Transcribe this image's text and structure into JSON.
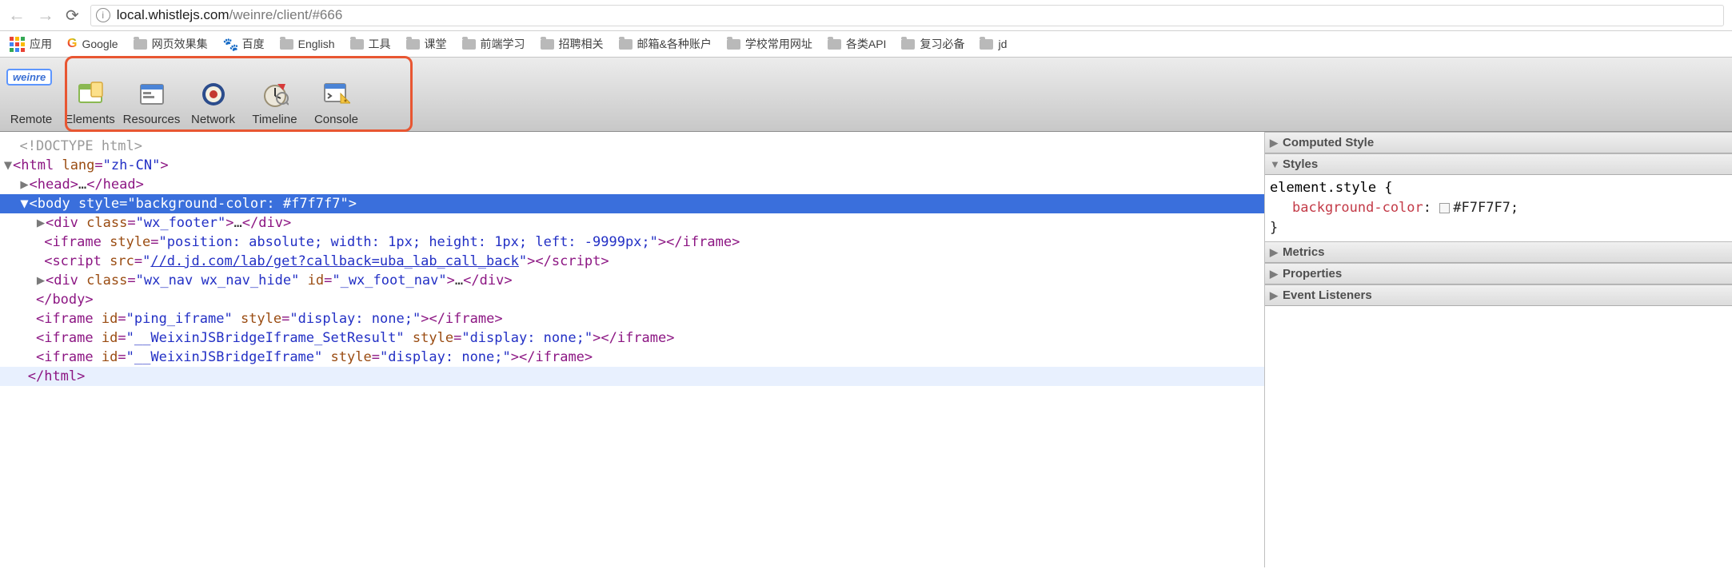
{
  "url": {
    "host": "local.whistlejs.com",
    "path": "/weinre/client/#666"
  },
  "bookmarks": {
    "apps": "应用",
    "google": "Google",
    "items": [
      "网页效果集",
      "百度",
      "English",
      "工具",
      "课堂",
      "前端学习",
      "招聘相关",
      "邮箱&各种账户",
      "学校常用网址",
      "各类API",
      "复习必备",
      "jd"
    ],
    "baidu_index": 1
  },
  "toolbar": {
    "badge": "weinre",
    "items": [
      "Remote",
      "Elements",
      "Resources",
      "Network",
      "Timeline",
      "Console"
    ]
  },
  "dom": {
    "doctype": "<!DOCTYPE html>",
    "html_open": {
      "tag": "html",
      "attr_name": "lang",
      "attr_val": "zh-CN"
    },
    "head": {
      "open_tag": "head",
      "ellipsis": "…",
      "close_tag": "/head"
    },
    "body_open": {
      "tag": "body",
      "attr_name": "style",
      "attr_val": "background-color: #f7f7f7"
    },
    "wx_footer": {
      "tag": "div",
      "a1": "class",
      "v1": "wx_footer",
      "ellipsis": "…",
      "close": "/div"
    },
    "iframe1": {
      "tag": "iframe",
      "a1": "style",
      "v1": "position: absolute; width: 1px; height: 1px; left: -9999px;",
      "close": "/iframe"
    },
    "script1": {
      "tag": "script",
      "a1": "src",
      "link": "//d.jd.com/lab/get?callback=uba_lab_call_back",
      "close": "/script"
    },
    "wx_nav": {
      "tag": "div",
      "a1": "class",
      "v1": "wx_nav wx_nav_hide",
      "a2": "id",
      "v2": "_wx_foot_nav",
      "ellipsis": "…",
      "close": "/div"
    },
    "body_close": "/body",
    "ping_iframe": {
      "tag": "iframe",
      "a1": "id",
      "v1": "ping_iframe",
      "a2": "style",
      "v2": "display: none;",
      "close": "/iframe"
    },
    "weixin_set": {
      "tag": "iframe",
      "a1": "id",
      "v1": "__WeixinJSBridgeIframe_SetResult",
      "a2": "style",
      "v2": "display: none;",
      "close": "/iframe"
    },
    "weixin": {
      "tag": "iframe",
      "a1": "id",
      "v1": "__WeixinJSBridgeIframe",
      "a2": "style",
      "v2": "display: none;",
      "close": "/iframe"
    },
    "html_close": "/html"
  },
  "sidebar": {
    "computed": "Computed Style",
    "styles": "Styles",
    "metrics": "Metrics",
    "properties": "Properties",
    "listeners": "Event Listeners",
    "rule": {
      "selector_open": "element.style {",
      "prop": "background-color",
      "val": "#F7F7F7",
      "close": "}"
    }
  },
  "glyphs": {
    "arrow_right": "▶",
    "arrow_down": "▼",
    "info": "i",
    "back": "←",
    "forward": "→",
    "reload": "⟳",
    "angle_lt": "<",
    "angle_gt": ">",
    "quote": "\"",
    "colon": ":",
    "semicolon": ";",
    "eq": "="
  }
}
